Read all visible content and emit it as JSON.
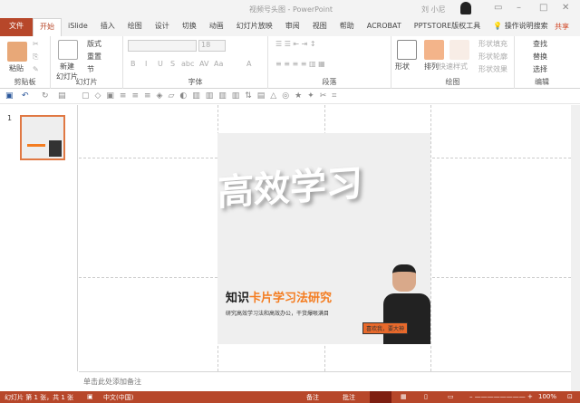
{
  "window": {
    "title": "视频号头图 - PowerPoint",
    "user": "刘 小尼"
  },
  "tabs": [
    "文件",
    "开始",
    "iSlide",
    "插入",
    "绘图",
    "设计",
    "切换",
    "动画",
    "幻灯片放映",
    "审阅",
    "视图",
    "帮助",
    "ACROBAT",
    "PPTSTORE版权工具"
  ],
  "tell_me": "操作说明搜索",
  "share": "共享",
  "ribbon": {
    "clipboard": {
      "label": "剪贴板",
      "paste": "粘贴"
    },
    "slides": {
      "label": "幻灯片",
      "new_slide": "新建\n幻灯片",
      "layout": "版式",
      "reset": "重置",
      "section": "节"
    },
    "font": {
      "label": "字体",
      "size": "18",
      "buttons": [
        "B",
        "I",
        "U",
        "S",
        "abc",
        "AV",
        "Aa",
        "A"
      ]
    },
    "paragraph": {
      "label": "段落"
    },
    "drawing": {
      "label": "绘图",
      "shapes": "形状",
      "arrange": "排列",
      "quick_styles": "快速样式",
      "fill": "形状填充",
      "outline": "形状轮廓",
      "effects": "形状效果"
    },
    "editing": {
      "label": "编辑",
      "find": "查找",
      "replace": "替换",
      "select": "选择"
    }
  },
  "thumbnails": [
    {
      "number": "1"
    }
  ],
  "slide": {
    "big_text": "高效学习",
    "title_black": "知识",
    "title_orange": "卡片学习法研究",
    "subtitle": "研究高效学习法和高效办公，干货爆哏满目",
    "badge": "喜欢我，要大神"
  },
  "notes_placeholder": "单击此处添加备注",
  "status": {
    "slide_info": "幻灯片 第 1 张，共 1 张",
    "language": "中文(中国)",
    "notes": "备注",
    "comments": "批注",
    "zoom": "100%"
  },
  "colors": {
    "accent": "#b7472a",
    "orange": "#f47c20"
  }
}
